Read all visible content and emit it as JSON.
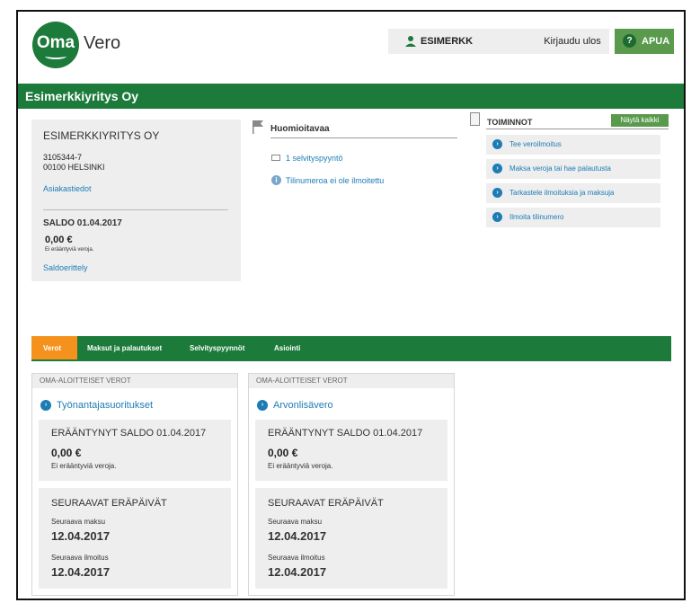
{
  "header": {
    "logo_oma": "Oma",
    "logo_vero": "Vero",
    "user_name": "ESIMERKK",
    "logout_label": "Kirjaudu ulos",
    "help_label": "APUA",
    "help_icon": "?"
  },
  "company_name": "Esimerkkiyritys Oy",
  "info": {
    "title": "ESIMERKKIYRITYS OY",
    "business_id": "3105344-7",
    "address": "00100 HELSINKI",
    "customer_link": "Asiakastiedot",
    "saldo_title": "SALDO 01.04.2017",
    "saldo_amount": "0,00 €",
    "saldo_note": "Ei erääntyviä veroja.",
    "saldo_link": "Saldoerittely"
  },
  "notices": {
    "title": "Huomioitavaa",
    "items": [
      "1 selvityspyyntö",
      "Tilinumeroa ei ole ilmoitettu"
    ]
  },
  "actions": {
    "title": "TOIMINNOT",
    "show_all": "Näytä kaikki",
    "items": [
      "Tee veroilmoitus",
      "Maksa veroja tai hae palautusta",
      "Tarkastele ilmoituksia ja maksuja",
      "Ilmoita tilinumero"
    ]
  },
  "tabs": [
    "Verot",
    "Maksut ja palautukset",
    "Selvityspyynnöt",
    "Asiointi"
  ],
  "cards": [
    {
      "header": "OMA-ALOITTEISET VEROT",
      "link": "Työnantajasuoritukset",
      "overdue_title": "ERÄÄNTYNYT SALDO 01.04.2017",
      "overdue_amount": "0,00 €",
      "overdue_note": "Ei erääntyviä veroja.",
      "due_title": "SEURAAVAT ERÄPÄIVÄT",
      "next_payment_label": "Seuraava maksu",
      "next_payment_date": "12.04.2017",
      "next_return_label": "Seuraava ilmoitus",
      "next_return_date": "12.04.2017"
    },
    {
      "header": "OMA-ALOITTEISET VEROT",
      "link": "Arvonlisävero",
      "overdue_title": "ERÄÄNTYNYT SALDO 01.04.2017",
      "overdue_amount": "0,00 €",
      "overdue_note": "Ei erääntyviä veroja.",
      "due_title": "SEURAAVAT ERÄPÄIVÄT",
      "next_payment_label": "Seuraava maksu",
      "next_payment_date": "12.04.2017",
      "next_return_label": "Seuraava ilmoitus",
      "next_return_date": "12.04.2017"
    }
  ],
  "icons": {
    "arrow": "›",
    "info": "i"
  },
  "colors": {
    "brand_green": "#1c7a3a",
    "accent_green": "#5a9a4d",
    "active_tab_orange": "#f5921e",
    "link_blue": "#1e7cb5"
  }
}
